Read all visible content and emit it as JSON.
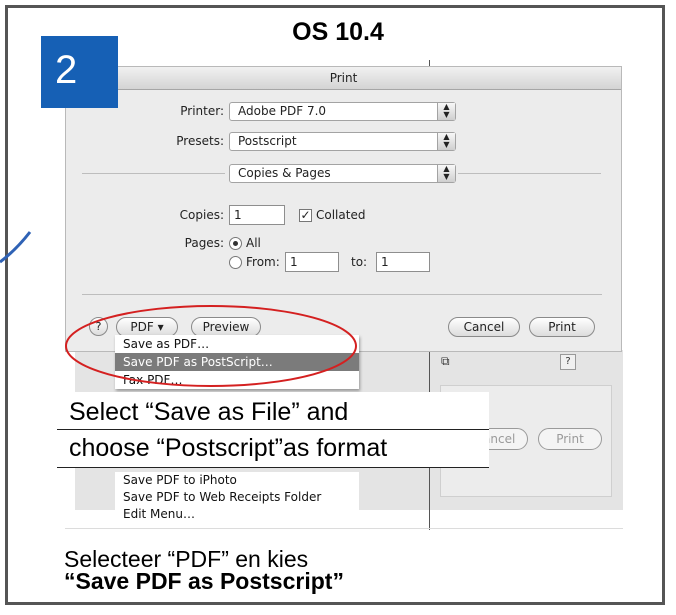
{
  "heading": {
    "os_title": "OS 10.4",
    "step_number": "2"
  },
  "dialog": {
    "title": "Print",
    "printer_label": "Printer:",
    "printer_value": "Adobe PDF 7.0",
    "presets_label": "Presets:",
    "presets_value": "Postscript",
    "section_value": "Copies & Pages",
    "copies_label": "Copies:",
    "copies_value": "1",
    "collated_label": "Collated",
    "collated_checked": true,
    "pages_label": "Pages:",
    "pages_all_label": "All",
    "pages_from_label": "From:",
    "pages_from_value": "1",
    "pages_to_label": "to:",
    "pages_to_value": "1",
    "help_label": "?",
    "pdf_button": "PDF ▾",
    "preview_button": "Preview",
    "cancel_button": "Cancel",
    "print_button": "Print"
  },
  "pdf_menu": {
    "items": [
      "Save as PDF…",
      "Save PDF as PostScript…",
      "Fax PDF…"
    ],
    "selected_index": 1,
    "lower_items": [
      "Save PDF to iPhoto",
      "Save PDF to Web Receipts Folder",
      "Edit Menu…"
    ]
  },
  "background_window": {
    "cancel_button": "Cancel",
    "print_button": "Print",
    "help_label": "?",
    "copy_icon": "copy-icon"
  },
  "callout": {
    "line1": "Select “Save as File” and",
    "line2": "choose “Postscript”as format"
  },
  "caption": {
    "line1": "Selecteer “PDF” en kies",
    "line2": "“Save PDF as Postscript”"
  },
  "colors": {
    "step_badge": "#1660b5",
    "highlight_ellipse": "#d42020",
    "frame": "#555555"
  }
}
